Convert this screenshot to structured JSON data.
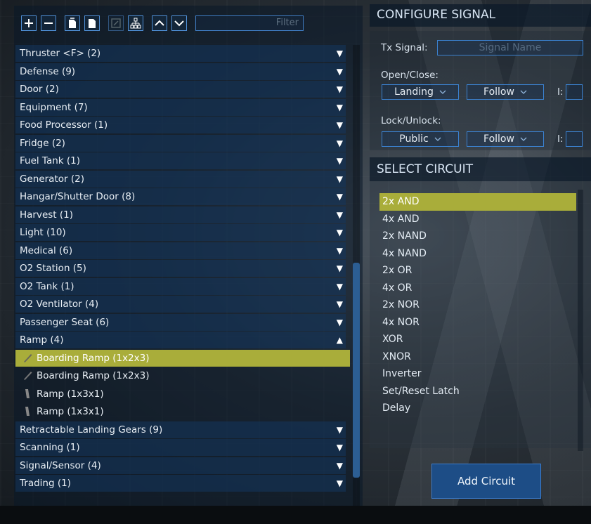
{
  "toolbar": {
    "buttons": [
      "add",
      "remove",
      "copy",
      "paste",
      "edit",
      "hierarchy",
      "move-up",
      "move-down"
    ],
    "filter_placeholder": "Filter"
  },
  "block_list": {
    "categories_top": [
      {
        "label": "Thruster <F> (2)"
      },
      {
        "label": "Defense (9)"
      },
      {
        "label": "Door (2)"
      },
      {
        "label": "Equipment (7)"
      },
      {
        "label": "Food Processor (1)"
      },
      {
        "label": "Fridge (2)"
      },
      {
        "label": "Fuel Tank (1)"
      },
      {
        "label": "Generator (2)"
      },
      {
        "label": "Hangar/Shutter Door (8)"
      },
      {
        "label": "Harvest (1)"
      },
      {
        "label": "Light (10)"
      },
      {
        "label": "Medical (6)"
      },
      {
        "label": "O2 Station (5)"
      },
      {
        "label": "O2 Tank (1)"
      },
      {
        "label": "O2 Ventilator (4)"
      },
      {
        "label": "Passenger Seat (6)"
      }
    ],
    "expanded_category": {
      "label": "Ramp (4)"
    },
    "ramp_items": [
      {
        "label": "Boarding Ramp (1x2x3)",
        "icon": "boarding-ramp-icon",
        "selected": true
      },
      {
        "label": "Boarding Ramp (1x2x3)",
        "icon": "boarding-ramp-icon",
        "selected": false
      },
      {
        "label": "Ramp (1x3x1)",
        "icon": "ramp-icon",
        "selected": false
      },
      {
        "label": "Ramp (1x3x1)",
        "icon": "ramp-icon",
        "selected": false
      }
    ],
    "categories_bottom": [
      {
        "label": "Retractable Landing Gears (9)"
      },
      {
        "label": "Scanning (1)"
      },
      {
        "label": "Signal/Sensor (4)"
      },
      {
        "label": "Trading (1)"
      }
    ],
    "collapsed_arrow": "▼",
    "expanded_arrow": "▲"
  },
  "configure_signal": {
    "title": "CONFIGURE SIGNAL",
    "tx_label": "Tx Signal:",
    "tx_placeholder": "Signal Name",
    "open_close_label": "Open/Close:",
    "open_close_mode": "Landing",
    "open_close_behavior": "Follow",
    "open_close_i_label": "I:",
    "lock_label": "Lock/Unlock:",
    "lock_mode": "Public",
    "lock_behavior": "Follow",
    "lock_i_label": "I:"
  },
  "select_circuit": {
    "title": "SELECT CIRCUIT",
    "items": [
      "2x AND",
      "4x AND",
      "2x NAND",
      "4x NAND",
      "2x OR",
      "4x OR",
      "2x NOR",
      "4x NOR",
      "XOR",
      "XNOR",
      "Inverter",
      "Set/Reset Latch",
      "Delay"
    ],
    "selected_index": 0,
    "add_button_label": "Add Circuit"
  },
  "colors": {
    "accent_blue": "#3b82d1",
    "selection_yellow": "#a9ad3a",
    "panel_navy": "#14375f"
  }
}
